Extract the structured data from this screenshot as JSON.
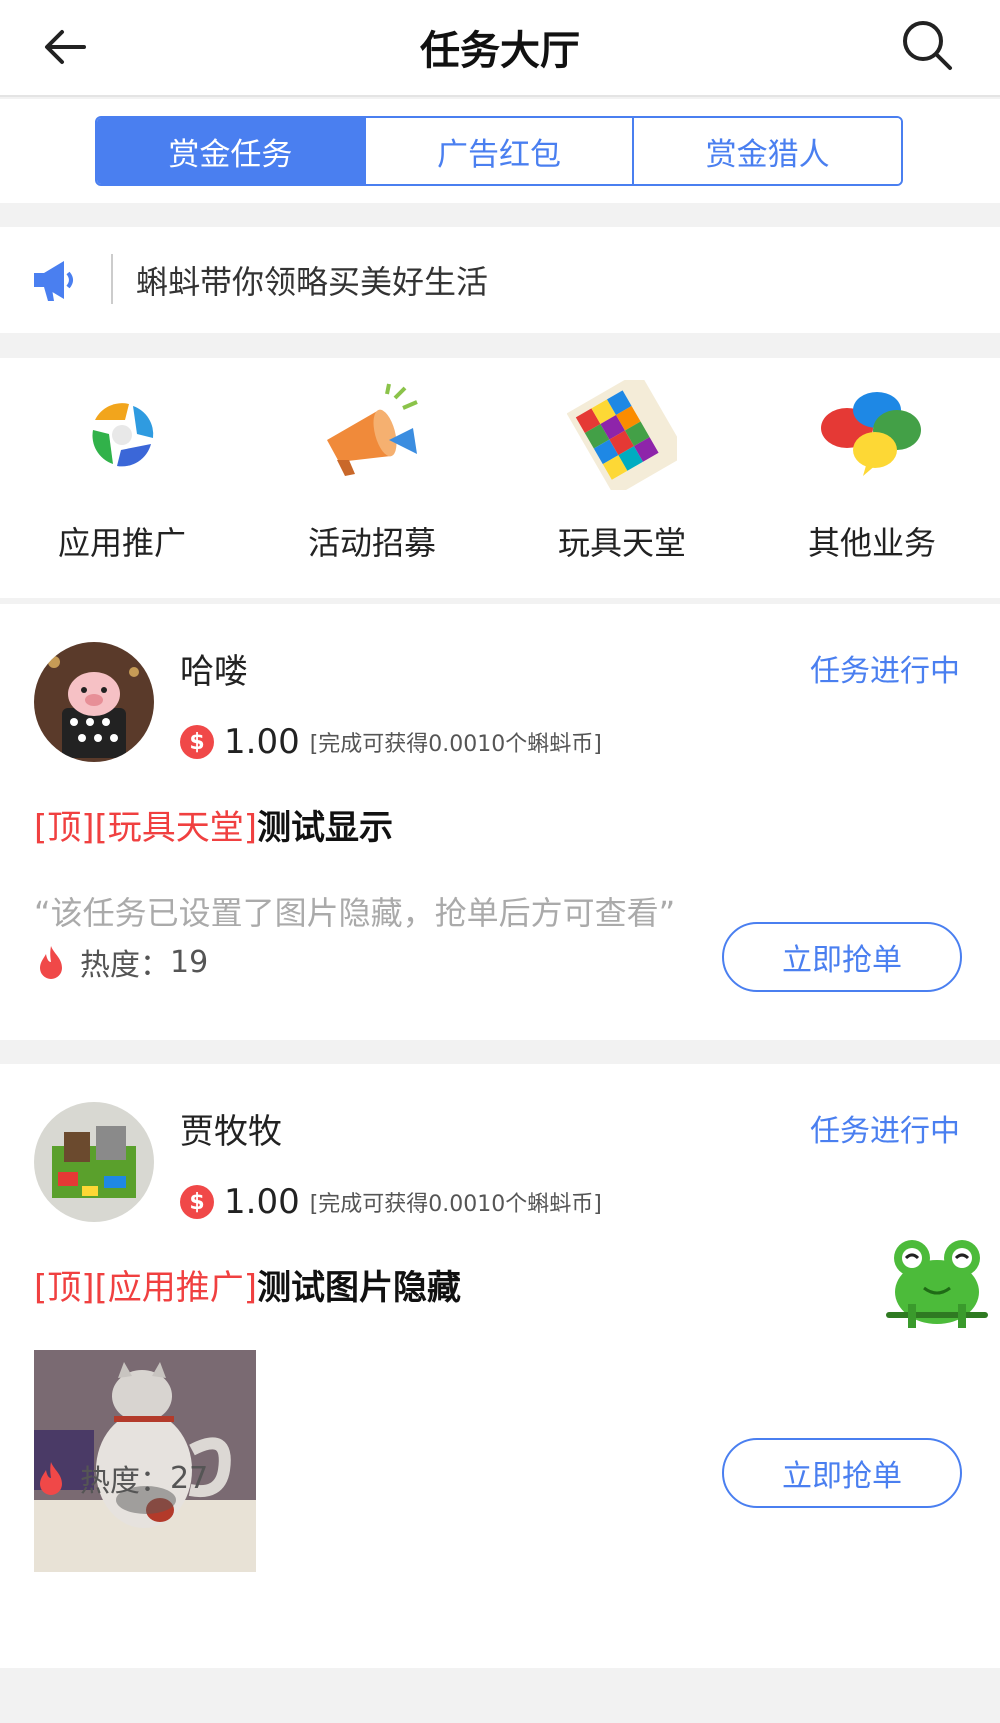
{
  "header": {
    "title": "任务大厅"
  },
  "tabs": [
    {
      "label": "赏金任务",
      "active": true
    },
    {
      "label": "广告红包",
      "active": false
    },
    {
      "label": "赏金猎人",
      "active": false
    }
  ],
  "notice": {
    "text": "蝌蚪带你领略买美好生活"
  },
  "categories": [
    {
      "label": "应用推广",
      "icon": "people-cycle-icon"
    },
    {
      "label": "活动招募",
      "icon": "megaphone-icon"
    },
    {
      "label": "玩具天堂",
      "icon": "puzzle-icon"
    },
    {
      "label": "其他业务",
      "icon": "chat-bubbles-icon"
    }
  ],
  "tasks": [
    {
      "user": "哈喽",
      "status": "任务进行中",
      "coin_symbol": "$",
      "price": "1.00",
      "price_note": "[完成可获得0.0010个蝌蚪币]",
      "tag": "[顶][玩具天堂]",
      "title": "测试显示",
      "hidden_note": "“该任务已设置了图片隐藏，抢单后方可查看”",
      "heat_label": "热度：",
      "heat": "19",
      "button": "立即抢单"
    },
    {
      "user": "贾牧牧",
      "status": "任务进行中",
      "coin_symbol": "$",
      "price": "1.00",
      "price_note": "[完成可获得0.0010个蝌蚪币]",
      "tag": "[顶][应用推广]",
      "title": "测试图片隐藏",
      "heat_label": "热度：",
      "heat": "27",
      "button": "立即抢单"
    }
  ],
  "colors": {
    "accent": "#4a7ff0",
    "tag": "#f04040",
    "coin": "#f04848"
  }
}
